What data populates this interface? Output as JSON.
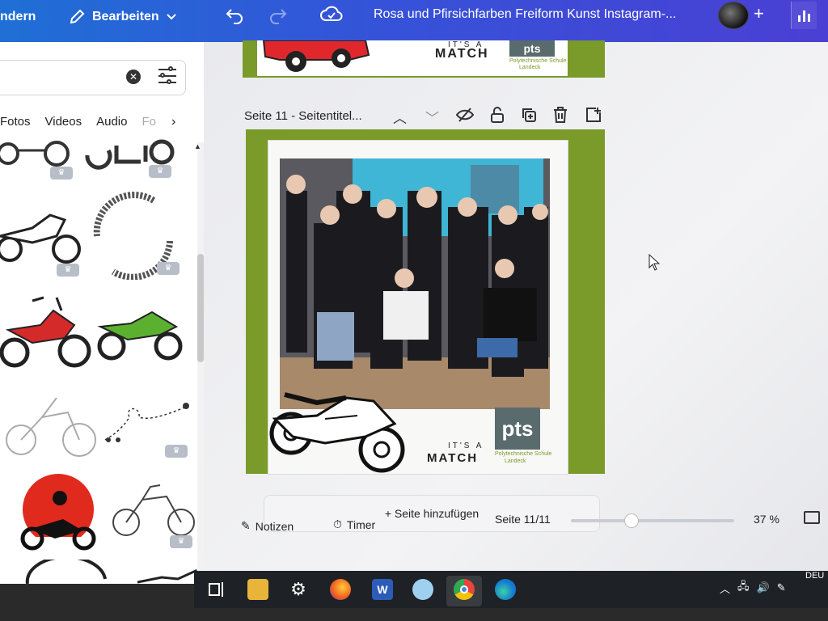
{
  "topbar": {
    "left_label": "ndern",
    "edit_label": "Bearbeiten",
    "title": "Rosa und Pfirsichfarben Freiform Kunst Instagram-..."
  },
  "sidebar": {
    "tabs": [
      {
        "label": "Fotos"
      },
      {
        "label": "Videos"
      },
      {
        "label": "Audio"
      },
      {
        "label": "Fo"
      }
    ]
  },
  "page_header": {
    "title": "Seite 11 - Seitentitel..."
  },
  "design": {
    "its_a": "IT'S A",
    "match": "MATCH",
    "pts": "pts",
    "school_name": "Polytechnische Schule",
    "school_city": "Landeck"
  },
  "canvas": {
    "add_page_label": "+ Seite hinzufügen"
  },
  "bottombar": {
    "notes_label": "Notizen",
    "timer_label": "Timer",
    "page_count": "Seite 11/11",
    "zoom": "37 %",
    "zoom_fraction": 0.37
  },
  "taskbar": {
    "lang": "DEU"
  },
  "colors": {
    "brand_gradient_start": "#1f6fd6",
    "brand_gradient_end": "#4a3fd4",
    "page_border_green": "#7a9a2a",
    "pts_logo": "#5a6b6e"
  },
  "icons": {
    "undo": "undo-icon",
    "redo": "redo-icon",
    "cloud": "cloud-sync-icon",
    "plus": "plus-icon",
    "stats": "bar-chart-icon",
    "search_clear": "clear-icon",
    "filter": "filter-sliders-icon",
    "page_up": "chevron-up-icon",
    "page_down": "chevron-down-icon",
    "hide": "eye-hide-icon",
    "lock": "lock-icon",
    "duplicate": "duplicate-icon",
    "delete": "trash-icon",
    "add": "add-page-icon"
  }
}
